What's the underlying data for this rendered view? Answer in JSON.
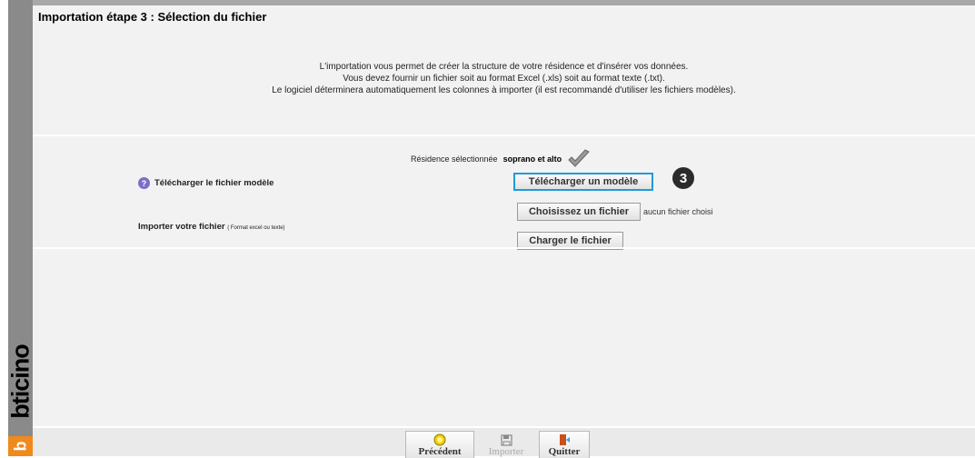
{
  "brand": {
    "name": "bticino",
    "letter": "b"
  },
  "header": {
    "title": "Importation étape 3 : Sélection du fichier"
  },
  "intro": {
    "line1": "L'importation vous permet de créer la structure de votre résidence et d'insérer vos données.",
    "line2": "Vous devez fournir un fichier soit au format Excel (.xls) soit au format texte (.txt).",
    "line3": "Le logiciel déterminera automatiquement les colonnes à importer (il est recommandé d'utiliser les fichiers modèles)."
  },
  "residence": {
    "label": "Résidence sélectionnée",
    "name": "soprano et alto"
  },
  "download_row": {
    "help_glyph": "?",
    "label": "Télécharger le fichier modèle",
    "button": "Télécharger un modèle"
  },
  "step_badge": "3",
  "import_row": {
    "label": "Importer votre fichier",
    "hint": "( Format excel ou texte)",
    "choose_button": "Choisissez un fichier",
    "no_file_text": "aucun fichier choisi",
    "load_button": "Charger le fichier"
  },
  "toolbar": {
    "previous": "Précédent",
    "import": "Importer",
    "quit": "Quitter"
  },
  "colors": {
    "accent": "#1f9bd6",
    "brand_orange": "#f08a1c",
    "panel": "#f2f2f2"
  }
}
